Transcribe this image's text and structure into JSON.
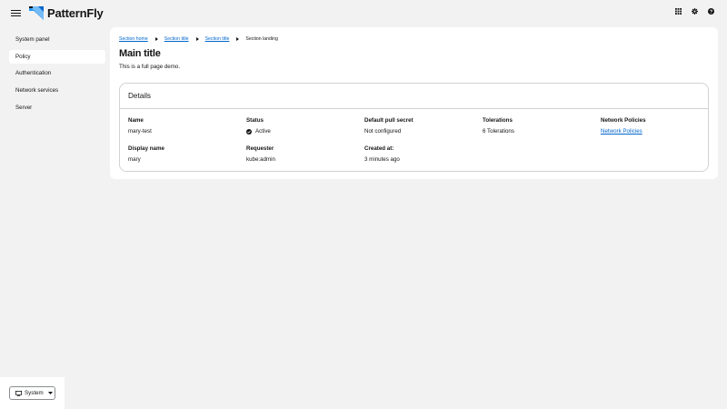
{
  "masthead": {
    "brand_name": "PatternFly",
    "brand_logo": "patternfly-logo",
    "menu_icon": "hamburger-icon",
    "tools": [
      "grid-icon",
      "gear-icon",
      "help-icon"
    ]
  },
  "sidebar": {
    "items": [
      {
        "label": "System panel",
        "active": false
      },
      {
        "label": "Policy",
        "active": true
      },
      {
        "label": "Authentication",
        "active": false
      },
      {
        "label": "Network services",
        "active": false
      },
      {
        "label": "Server",
        "active": false
      }
    ],
    "theme_selector": {
      "label": "System",
      "icon": "monitor-icon"
    }
  },
  "breadcrumb": {
    "items": [
      "Section home",
      "Section title",
      "Section title"
    ],
    "current": "Section landing"
  },
  "page": {
    "title": "Main title",
    "description": "This is a full page demo."
  },
  "details": {
    "title": "Details",
    "fields": {
      "name": {
        "term": "Name",
        "value": "mary-test"
      },
      "status": {
        "term": "Status",
        "value": "Active"
      },
      "pull_secret": {
        "term": "Default pull secret",
        "value": "Not configured"
      },
      "tolerations": {
        "term": "Tolerations",
        "value": "6 Tolerations"
      },
      "network_policies": {
        "term": "Network Policies",
        "value": "Network Policies"
      },
      "display_name": {
        "term": "Display name",
        "value": "mary"
      },
      "requester": {
        "term": "Requester",
        "value": "kube:admin"
      },
      "created_at": {
        "term": "Created at:",
        "value": "3 minutes ago"
      }
    }
  },
  "colors": {
    "background": "#f2f2f2",
    "panel": "#ffffff",
    "link": "#0066cc",
    "text": "#151515",
    "border": "#d2d2d2",
    "logo_dark": "#0066cc",
    "logo_light": "#73bcf7"
  }
}
